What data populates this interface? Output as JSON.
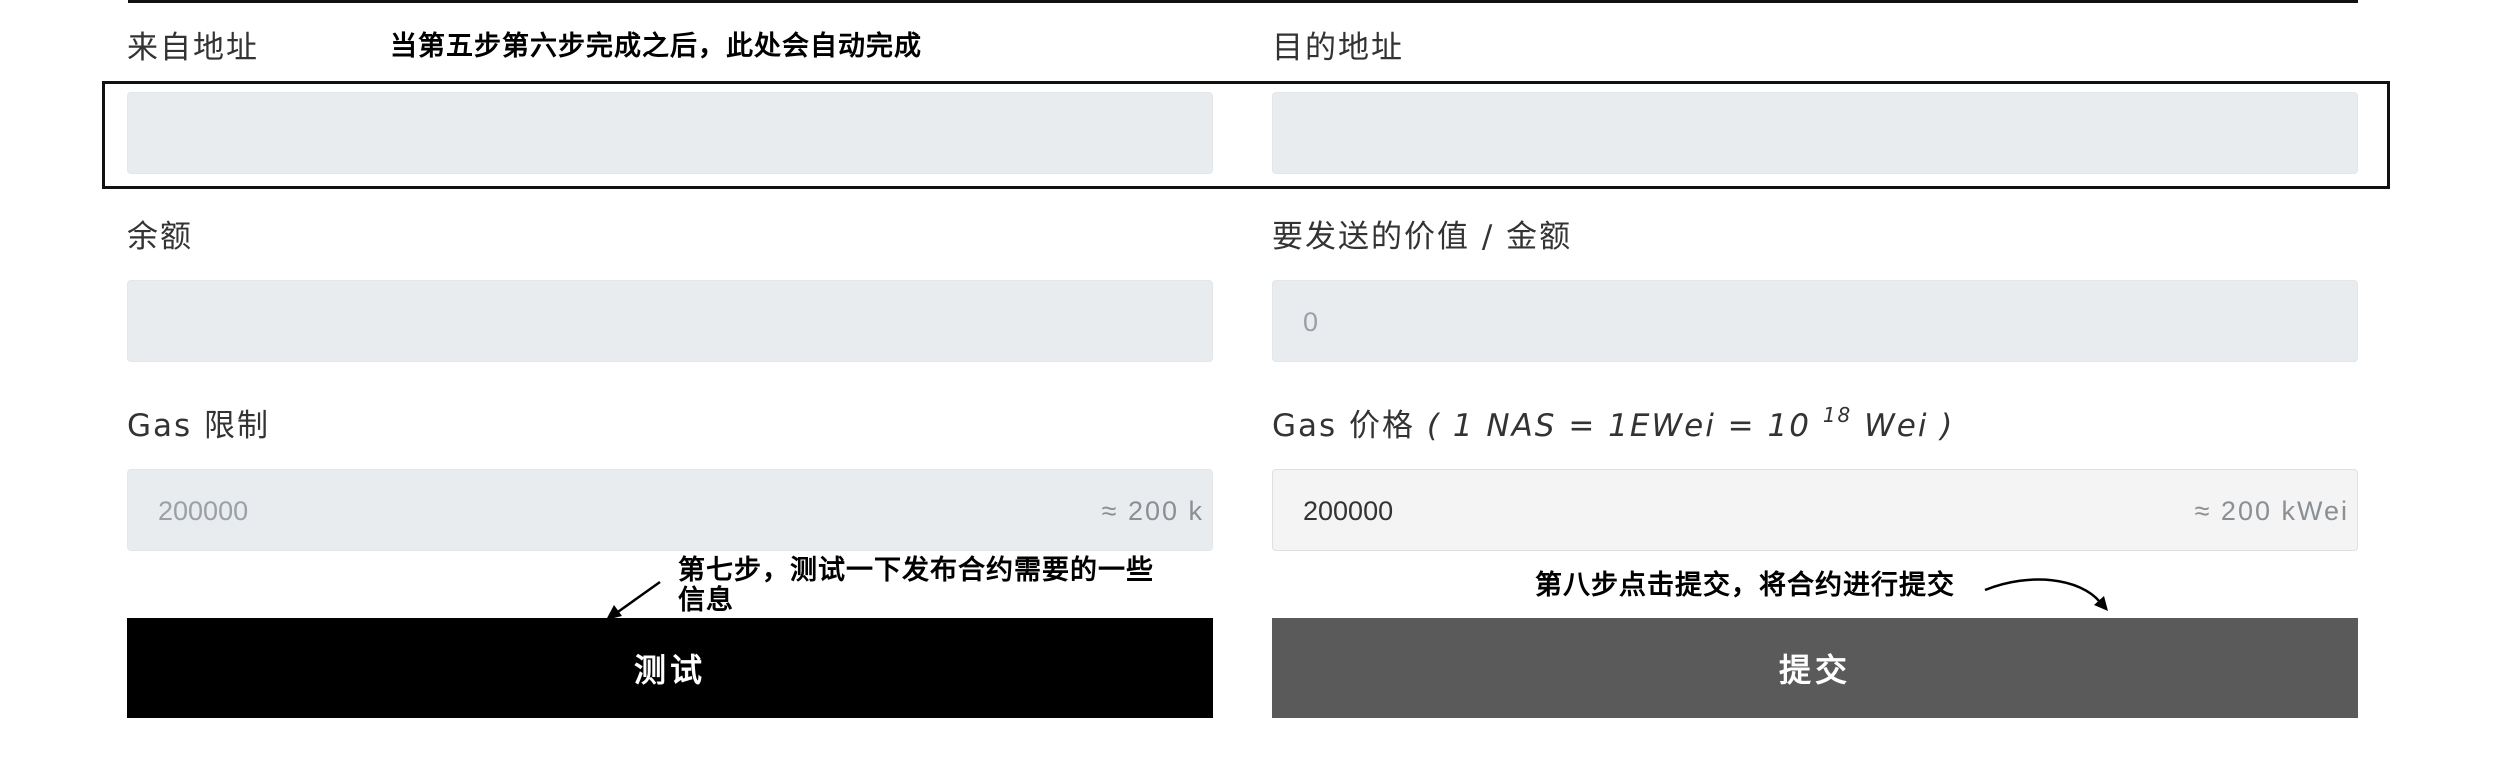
{
  "from_address": {
    "label": "来自地址",
    "value": ""
  },
  "to_address": {
    "label": "目的地址",
    "value": ""
  },
  "balance": {
    "label": "余额",
    "value": ""
  },
  "amount": {
    "label": "要发送的价值 / 金额",
    "placeholder": "0",
    "value": ""
  },
  "gas_limit": {
    "label": "Gas 限制",
    "value": "200000",
    "suffix": "≈ 200 k"
  },
  "gas_price": {
    "label_prefix": "Gas 价格",
    "label_formula": "( 1 NAS = 1EWei = 10 ",
    "label_exponent": "18",
    "label_unit": " Wei )",
    "value": "200000",
    "suffix": "≈ 200 kWei"
  },
  "buttons": {
    "test_label": "测试",
    "submit_label": "提交"
  },
  "annotations": {
    "auto_complete": "当第五步第六步完成之后，此处会自动完成",
    "step7_line1": "第七步，测试一下发布合约需要的一些",
    "step7_line2": "信息",
    "step8": "第八步点击提交，将合约进行提交"
  },
  "colors": {
    "test_button": "#000000",
    "submit_button": "#5a5a5a",
    "field_bg": "#e9ecef"
  }
}
